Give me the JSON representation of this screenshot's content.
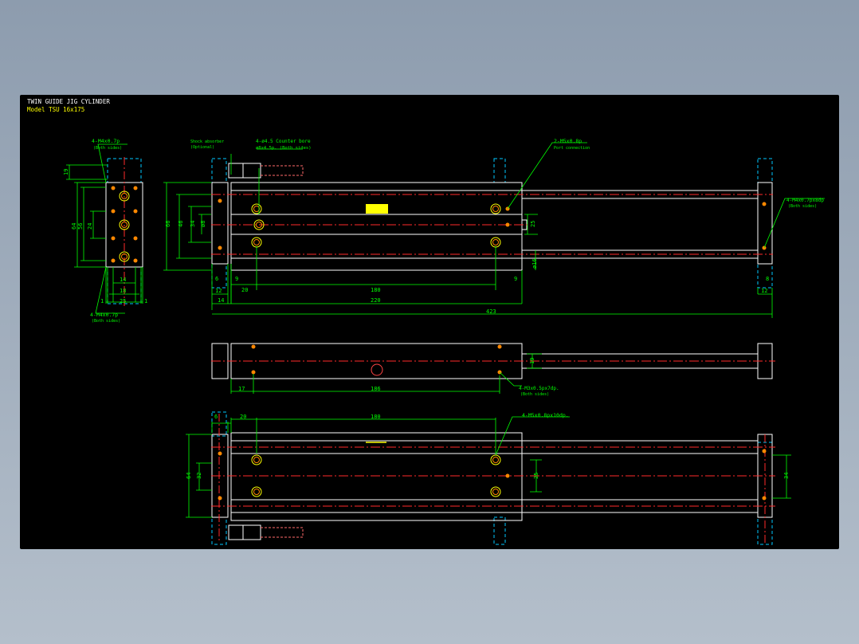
{
  "title_block": {
    "title": "TWIN GUIDE JIG CYLINDER",
    "model": "Model TSU 16x175"
  },
  "callouts": {
    "end_top": "4-M4x0.7p",
    "end_top_note": "(Both sides)",
    "end_bottom": "4-M4x0.7p",
    "end_bottom_note": "(Both sides)",
    "shock": "Shock absorber",
    "shock_note": "(Optional)",
    "bore": "4-ø4.5 Counter bore",
    "bore_note": "ø8x4.5p. (Both sides)",
    "port": "2-M5x0.8p",
    "port_note": "Port connection",
    "rod_end": "4-M4x0.7px8dp",
    "rod_end_note": "(Both sides)",
    "side_holes": "4-M3x0.5px7dp.",
    "side_holes_note": "(Both sides)",
    "bottom_holes": "4-M5x0.8px10dp."
  },
  "dims": {
    "d19": "19",
    "d64": "64",
    "d56": "56",
    "d24": "24",
    "d14": "14",
    "d18": "18",
    "d25": "25",
    "d1a": "1",
    "d1b": "1",
    "d66": "66",
    "d46": "46",
    "d34": "34",
    "phi8": "ø8",
    "phi16": "ø16",
    "d6": "6",
    "d9": "9",
    "d20": "20",
    "d180": "180",
    "d9b": "9",
    "d12": "12",
    "d14b": "14",
    "d220": "220",
    "d423": "423",
    "d12b": "12",
    "d8": "8",
    "d25b": "25",
    "d19b": "19",
    "d17": "17",
    "d186": "186",
    "d6c": "6",
    "d20c": "20",
    "d180c": "180",
    "d64c": "64",
    "d32c": "32",
    "d25c": "25",
    "d34c": "34"
  },
  "colors": {
    "outline": "#ffffff",
    "dimension": "#00ff00",
    "centerline": "#ff2a2a",
    "hidden": "#00c8ff",
    "accent": "#ffff00"
  }
}
